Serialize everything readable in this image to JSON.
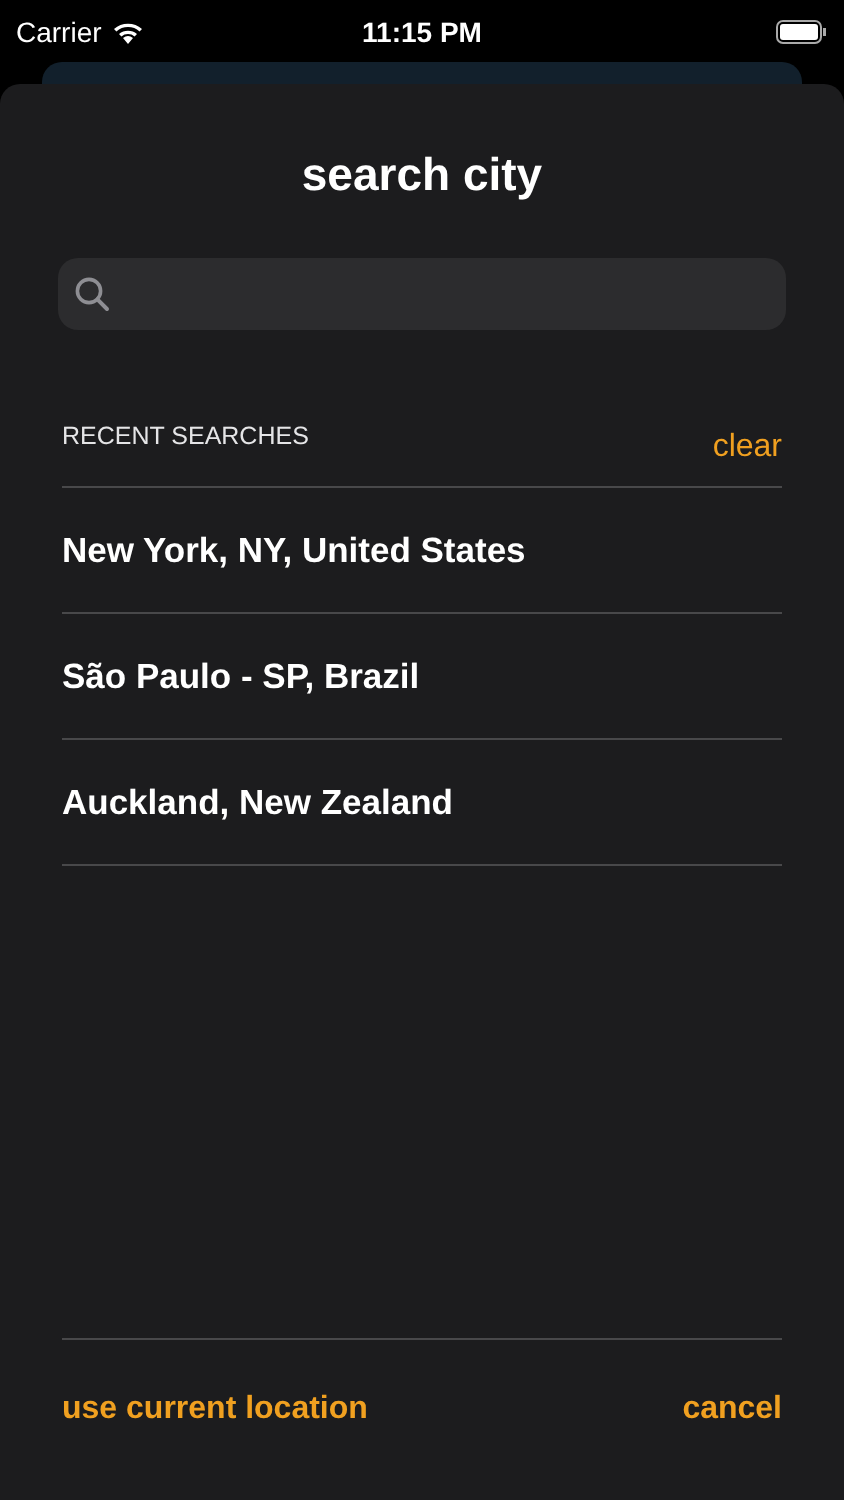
{
  "status_bar": {
    "carrier": "Carrier",
    "time": "11:15 PM"
  },
  "sheet": {
    "title": "search city",
    "search": {
      "kind": "search"
    },
    "recent": {
      "heading": "RECENT SEARCHES",
      "clear": "clear",
      "items": [
        {
          "label": "New York, NY, United States"
        },
        {
          "label": "São Paulo - SP, Brazil"
        },
        {
          "label": "Auckland, New Zealand"
        }
      ]
    },
    "footer": {
      "left": "use current location",
      "right": "cancel"
    }
  }
}
